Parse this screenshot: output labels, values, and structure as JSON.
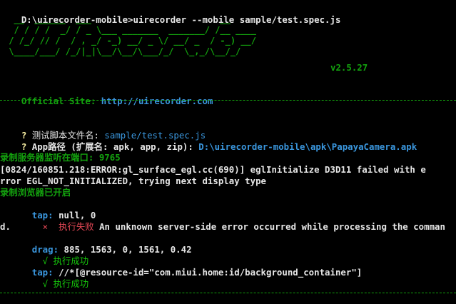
{
  "terminal": {
    "prompt": "D:\\uirecorder-mobile>",
    "command": "uirecorder --mobile sample/test.spec.js",
    "logo_art": [
      "  __  ______  ___                         __",
      "  / / / /  _/ / _ \\___ _______  _______/ /__ ____",
      " / /_/ // /  / , _/ -_) __/ _ \\/ __/ _  / -_) __/",
      " \\____/___/ /_/|_|\\__/\\__/\\___/_/  \\_,_/\\__/_/"
    ],
    "version": "v2.5.27",
    "official_site_label": "Official Site: ",
    "official_site_url": "http://uirecorder.com",
    "q1_mark": "? ",
    "q1_label": "测试脚本文件名: ",
    "q1_value": "sample/test.spec.js",
    "q2_mark": "? ",
    "q2_label": "App路径 (扩展名: apk, app, zip): ",
    "q2_value": "D:\\uirecorder-mobile\\apk\\PapayaCamera.apk",
    "server_line": "录制服务器监听在端口: 9765",
    "error_line_1": "[0824/160851.218:ERROR:gl_surface_egl.cc(690)] eglInitialize D3D11 failed with e",
    "error_line_2": "rror EGL_NOT_INITIALIZED, trying next display type",
    "browser_opened": "录制浏览器已开启",
    "tap1_label": "  tap: ",
    "tap1_value": "null, 0",
    "fail_mark": "    ×  ",
    "fail_label": "执行失败",
    "fail_message": " An unknown server-side error occurred while processing the comman",
    "fail_message_cont": "d.",
    "drag_label": "  drag: ",
    "drag_value": "885, 1563, 0, 1561, 0.42",
    "ok1_mark": "    √ ",
    "ok1_label": "执行成功",
    "tap2_label": "  tap: ",
    "tap2_value": "//*[@resource-id=\"com.miui.home:id/background_container\"]",
    "ok2_mark": "    √ ",
    "ok2_label": "执行成功"
  }
}
